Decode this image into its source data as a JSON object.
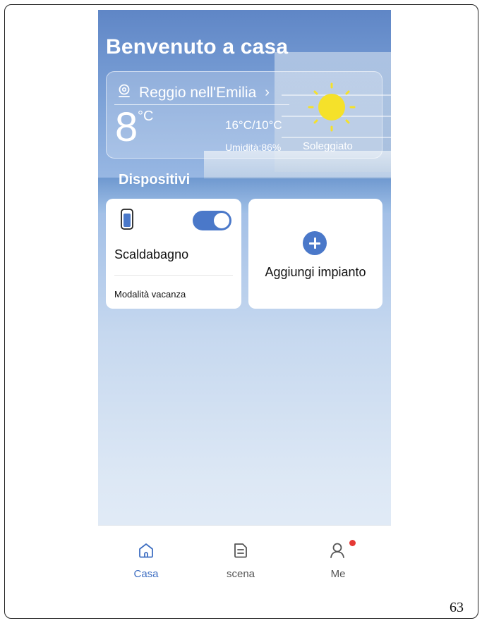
{
  "header": {
    "title": "Benvenuto a casa"
  },
  "weather": {
    "location": "Reggio nell'Emilia",
    "temperature": "8",
    "unit": "°C",
    "range": "16°C/10°C",
    "humidity": "Umidità:86%",
    "condition": "Soleggiato",
    "icon": "sun-icon"
  },
  "devices": {
    "section_title": "Dispositivi",
    "items": [
      {
        "name": "Scaldabagno",
        "mode": "Modalità vacanza",
        "power": true,
        "icon": "water-heater-icon"
      }
    ],
    "add_label": "Aggiungi impianto"
  },
  "tabs": [
    {
      "label": "Casa",
      "icon": "home-icon",
      "active": true
    },
    {
      "label": "scena",
      "icon": "scene-icon",
      "active": false
    },
    {
      "label": "Me",
      "icon": "user-icon",
      "active": false,
      "badge": true
    }
  ],
  "colors": {
    "accent": "#4a78c9",
    "badge": "#e53935"
  },
  "page_number": "63"
}
